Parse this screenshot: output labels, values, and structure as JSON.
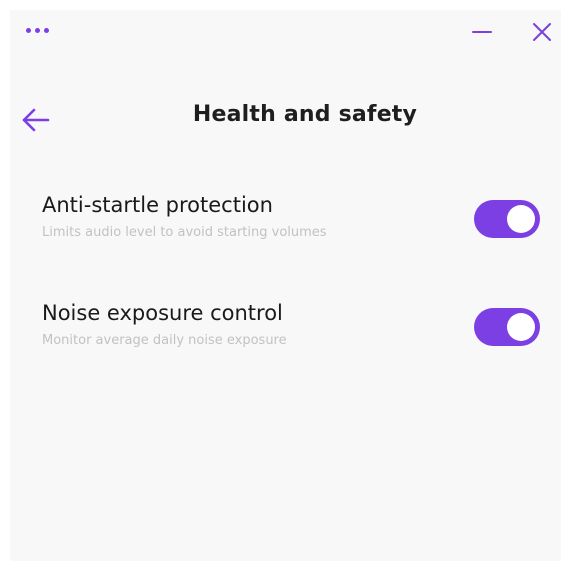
{
  "colors": {
    "accent": "#7b3fe4"
  },
  "titlebar": {
    "more_icon": "more-horizontal-icon",
    "minimize_icon": "minimize-icon",
    "close_icon": "close-icon"
  },
  "header": {
    "back_icon": "arrow-left-icon",
    "title": "Health and safety"
  },
  "settings": [
    {
      "label": "Anti-startle protection",
      "description": "Limits audio level to avoid starting volumes",
      "enabled": true
    },
    {
      "label": "Noise exposure control",
      "description": "Monitor average daily noise exposure",
      "enabled": true
    }
  ]
}
